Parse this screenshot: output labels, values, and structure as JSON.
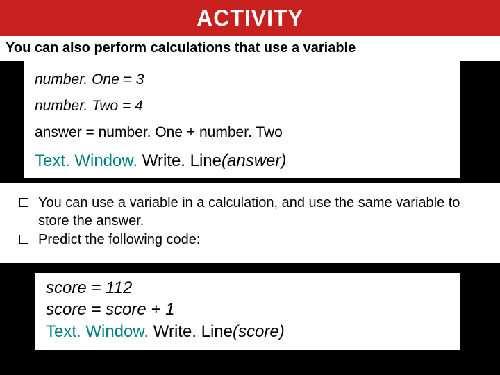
{
  "header": {
    "title": "ACTIVITY"
  },
  "intro": "You can also perform calculations that use a variable",
  "code1": {
    "line1": "number. One = 3",
    "line2": "number. Two = 4",
    "line3": "answer = number. One + number. Two",
    "final_tw": "Text. Window. ",
    "final_wl": "Write. Line",
    "final_arg": "(answer)"
  },
  "bullets": {
    "b1": "You can use a variable in a calculation, and use the same variable to store the answer.",
    "b2": "Predict the following code:"
  },
  "code2": {
    "line1": "score = 112",
    "line2": "score = score + 1",
    "final_tw": "Text. Window. ",
    "final_wl": "Write. Line",
    "final_arg": "(score)"
  }
}
